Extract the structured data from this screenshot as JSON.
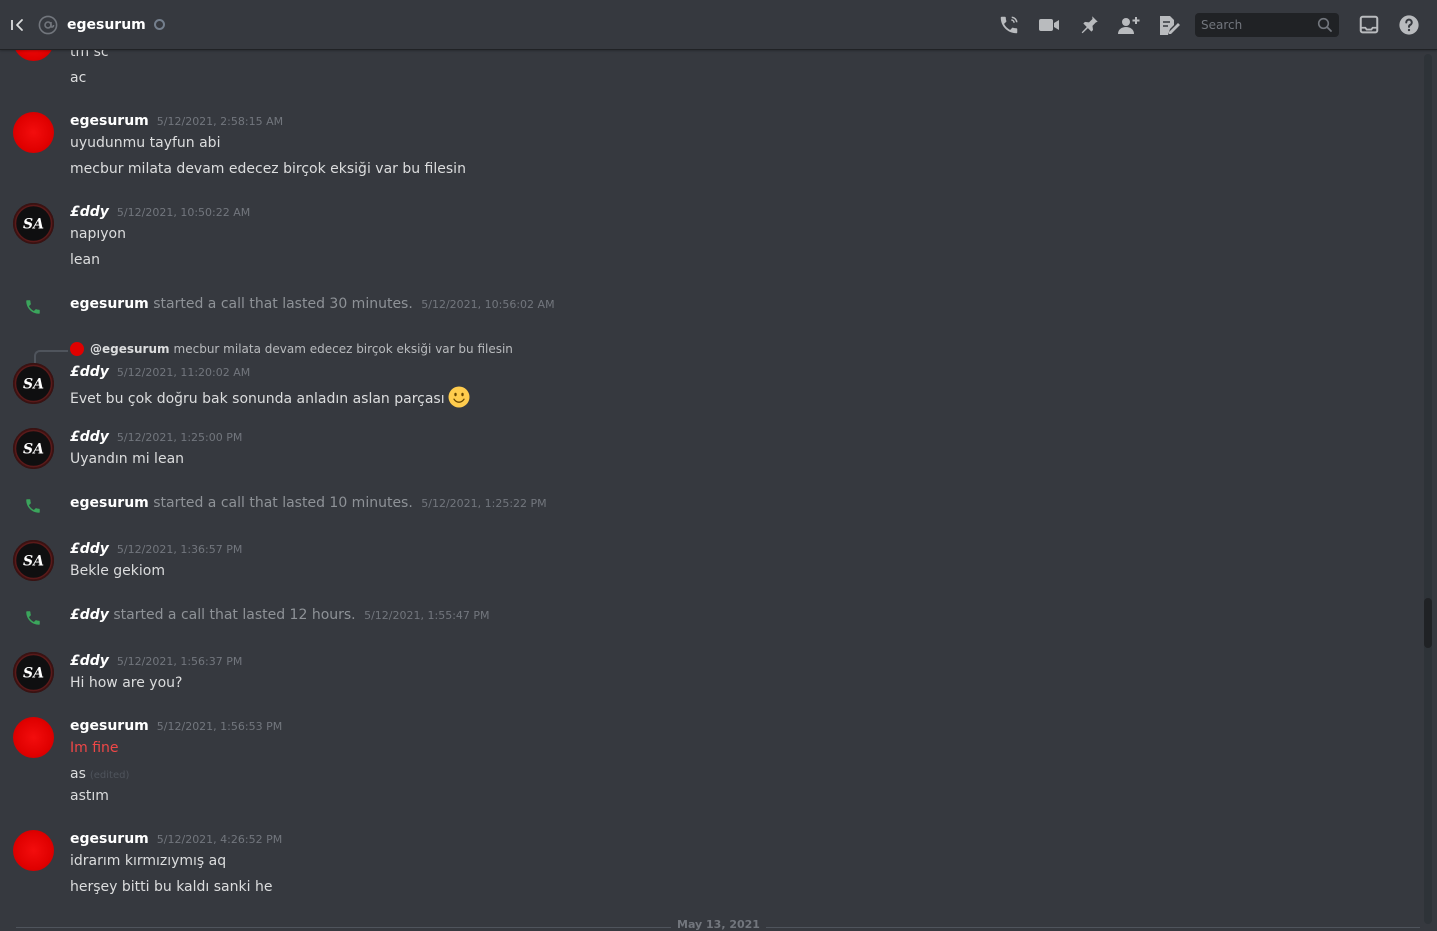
{
  "header": {
    "channel_name": "egesurum",
    "search_placeholder": "Search",
    "icons": [
      "back-icon",
      "at-icon",
      "status-icon",
      "voice-call-icon",
      "video-call-icon",
      "pin-icon",
      "add-friend-icon",
      "send-file-icon",
      "search-icon",
      "inbox-icon",
      "help-icon"
    ]
  },
  "messages": [
    {
      "lines": [
        "tm sc",
        "ac"
      ]
    },
    {
      "author": "egesurum",
      "timestamp": "5/12/2021, 2:58:15 AM",
      "lines": [
        "uyudunmu tayfun abi",
        "mecbur milata devam edecez birçok eksiği var bu filesin"
      ]
    },
    {
      "author": "£ddy",
      "timestamp": "5/12/2021, 10:50:22 AM",
      "lines": [
        "napıyon",
        "lean"
      ]
    },
    {
      "system": true,
      "author": "egesurum",
      "text": "started a call that lasted 30 minutes.",
      "timestamp": "5/12/2021, 10:56:02 AM"
    },
    {
      "author": "£ddy",
      "timestamp": "5/12/2021, 11:20:02 AM",
      "reply": {
        "mention": "@egesurum",
        "text": "mecbur milata devam edecez birçok eksiği var bu filesin"
      },
      "lines": [
        "Evet bu çok doğru bak sonunda anladın aslan parçası"
      ],
      "emoji": "slightly-smiling-face"
    },
    {
      "author": "£ddy",
      "timestamp": "5/12/2021, 1:25:00 PM",
      "lines": [
        "Uyandın mi lean"
      ]
    },
    {
      "system": true,
      "author": "egesurum",
      "text": "started a call that lasted 10 minutes.",
      "timestamp": "5/12/2021, 1:25:22 PM"
    },
    {
      "author": "£ddy",
      "timestamp": "5/12/2021, 1:36:57 PM",
      "lines": [
        "Bekle gekiom"
      ]
    },
    {
      "system": true,
      "author": "£ddy",
      "text": "started a call that lasted 12 hours.",
      "timestamp": "5/12/2021, 1:55:47 PM"
    },
    {
      "author": "£ddy",
      "timestamp": "5/12/2021, 1:56:37 PM",
      "lines": [
        "Hi how are you?"
      ]
    },
    {
      "author": "egesurum",
      "timestamp": "5/12/2021, 1:56:53 PM",
      "lines": [
        "Im fine",
        "as",
        "astım"
      ],
      "edited_label": "(edited)"
    },
    {
      "author": "egesurum",
      "timestamp": "5/12/2021, 4:26:52 PM",
      "lines": [
        "idrarım kırmızıymış aq",
        "herşey bitti bu kaldı sanki he"
      ]
    }
  ],
  "date_divider": "May 13, 2021",
  "colors": {
    "background": "#36393f",
    "header_border": "#202225",
    "call_green": "#3ba55c",
    "red_text": "#f04747",
    "avatar_red": "#e00000"
  }
}
